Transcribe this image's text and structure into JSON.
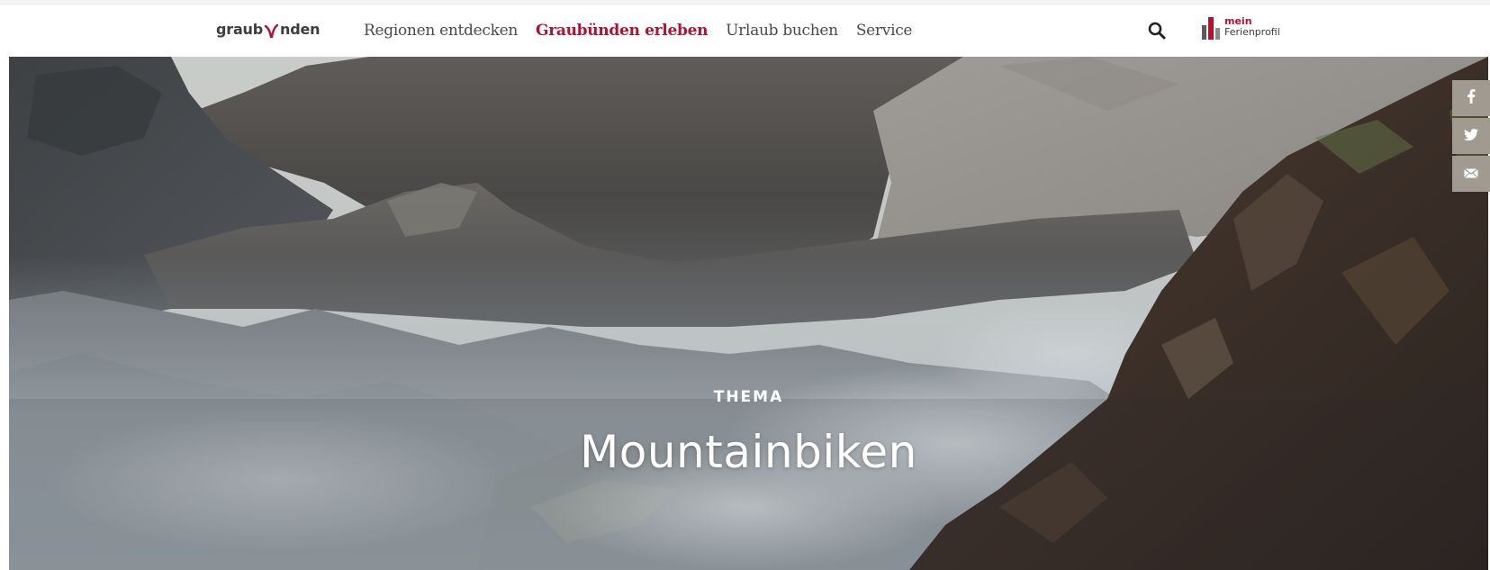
{
  "header": {
    "logo_text_left": "graub",
    "logo_text_right": "nden",
    "nav": [
      {
        "label": "Regionen entdecken",
        "active": false
      },
      {
        "label": "Graubünden erleben",
        "active": true
      },
      {
        "label": "Urlaub buchen",
        "active": false
      },
      {
        "label": "Service",
        "active": false
      }
    ],
    "search_icon": "search-icon",
    "profile": {
      "line1": "mein",
      "line2": "Ferienprofil"
    }
  },
  "hero": {
    "kicker": "THEMA",
    "title": "Mountainbiken"
  },
  "share": {
    "items": [
      {
        "icon": "facebook-icon",
        "glyph": "f"
      },
      {
        "icon": "twitter-icon",
        "glyph": "🐦"
      },
      {
        "icon": "mail-icon",
        "glyph": "✉"
      }
    ]
  },
  "colors": {
    "accent": "#b0122f",
    "nav_text": "#4a4a4a",
    "share_bg": "#a09a90"
  }
}
